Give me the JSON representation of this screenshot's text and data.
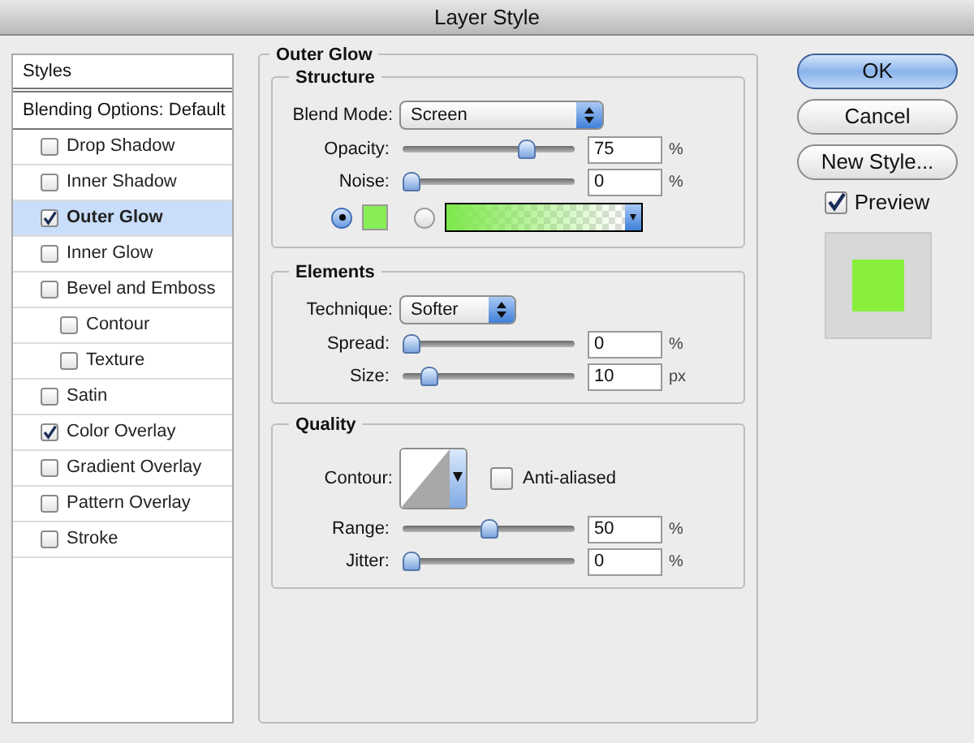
{
  "window": {
    "title": "Layer Style"
  },
  "sidebar": {
    "header": "Styles",
    "blending": "Blending Options: Default",
    "items": [
      {
        "label": "Drop Shadow",
        "checked": false,
        "selected": false
      },
      {
        "label": "Inner Shadow",
        "checked": false,
        "selected": false
      },
      {
        "label": "Outer Glow",
        "checked": true,
        "selected": true
      },
      {
        "label": "Inner Glow",
        "checked": false,
        "selected": false
      },
      {
        "label": "Bevel and Emboss",
        "checked": false,
        "selected": false,
        "children": [
          {
            "label": "Contour",
            "checked": false,
            "selected": false
          },
          {
            "label": "Texture",
            "checked": false,
            "selected": false
          }
        ]
      },
      {
        "label": "Satin",
        "checked": false,
        "selected": false
      },
      {
        "label": "Color Overlay",
        "checked": true,
        "selected": false
      },
      {
        "label": "Gradient Overlay",
        "checked": false,
        "selected": false
      },
      {
        "label": "Pattern Overlay",
        "checked": false,
        "selected": false
      },
      {
        "label": "Stroke",
        "checked": false,
        "selected": false
      }
    ]
  },
  "panel": {
    "title": "Outer Glow",
    "structure": {
      "title": "Structure",
      "blend_mode": {
        "label": "Blend Mode:",
        "value": "Screen"
      },
      "sliders": [
        {
          "label": "Opacity:",
          "level": 0.75,
          "value": "75",
          "unit": "%"
        },
        {
          "label": "Noise:",
          "level": 0,
          "value": "0",
          "unit": "%"
        }
      ],
      "fill_options": [
        {
          "kind": "color",
          "selected": true
        },
        {
          "kind": "gradient",
          "selected": false
        }
      ]
    },
    "elements": {
      "title": "Elements",
      "technique": {
        "label": "Technique:",
        "value": "Softer"
      },
      "sliders": [
        {
          "label": "Spread:",
          "level": 0,
          "value": "0",
          "unit": "%"
        },
        {
          "label": "Size:",
          "level": 0.12,
          "value": "10",
          "unit": "px"
        }
      ]
    },
    "quality": {
      "title": "Quality",
      "contour_label": "Contour:",
      "anti_aliased": {
        "label": "Anti-aliased",
        "checked": false
      },
      "sliders": [
        {
          "label": "Range:",
          "level": 0.5,
          "value": "50",
          "unit": "%"
        },
        {
          "label": "Jitter:",
          "level": 0,
          "value": "0",
          "unit": "%"
        }
      ]
    }
  },
  "buttons": [
    {
      "label": "OK",
      "default": true
    },
    {
      "label": "Cancel",
      "default": false
    },
    {
      "label": "New Style...",
      "default": false
    }
  ],
  "preview": {
    "label": "Preview",
    "checked": true
  }
}
